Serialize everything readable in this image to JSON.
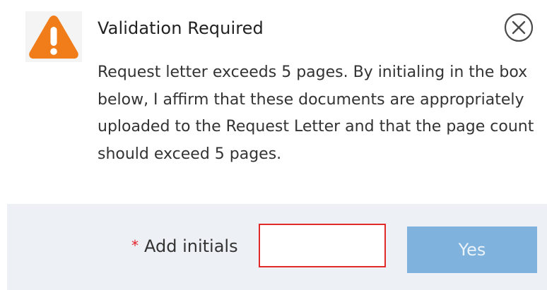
{
  "dialog": {
    "title": "Validation Required",
    "message": "Request letter exceeds 5 pages. By initialing in the box below, I affirm that these documents are appropriately uploaded to the Request Letter and that the page count should exceed 5 pages.",
    "icons": {
      "warning": "warning-triangle-icon",
      "close": "close-circle-icon"
    }
  },
  "footer": {
    "required_marker": "*",
    "initials_label": "Add initials",
    "initials_value": "",
    "yes_label": "Yes"
  },
  "colors": {
    "warning_orange": "#f07d19",
    "required_red": "#e0242a",
    "input_error_border": "#e02a2a",
    "button_blue": "#7fb2dc",
    "footer_background": "#edf0f5"
  }
}
